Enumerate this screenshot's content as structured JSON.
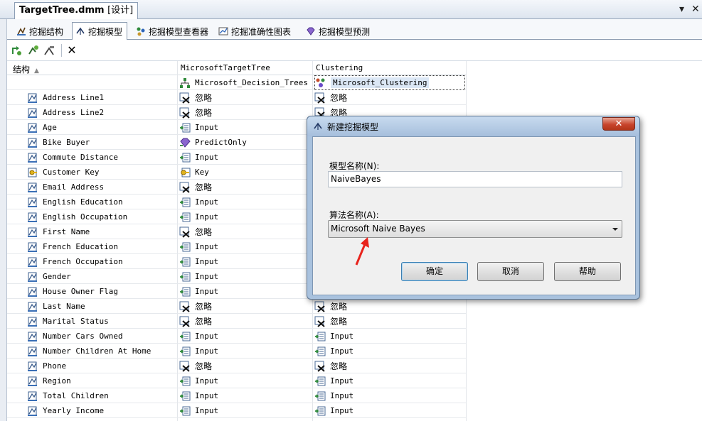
{
  "document": {
    "tab_title": "TargetTree.dmm",
    "tab_mode": "[设计]",
    "controls": [
      "▾",
      "✕"
    ]
  },
  "designer_tabs": [
    {
      "label": "挖掘结构",
      "icon": "mining-structure-icon"
    },
    {
      "label": "挖掘模型",
      "icon": "mining-model-icon"
    },
    {
      "label": "挖掘模型查看器",
      "icon": "model-viewer-icon"
    },
    {
      "label": "挖掘准确性图表",
      "icon": "accuracy-chart-icon"
    },
    {
      "label": "挖掘模型预测",
      "icon": "prediction-icon"
    }
  ],
  "toolbar": {
    "buttons": [
      "new-model-icon",
      "process-icon",
      "settings-icon",
      "delete-icon"
    ],
    "delete_glyph": "✕"
  },
  "grid": {
    "headers": {
      "structure": "结构",
      "sort_glyph": "▲",
      "model1": "MicrosoftTargetTree",
      "model2": "Clustering"
    },
    "algorithms": {
      "model1": "Microsoft_Decision_Trees",
      "model2": "Microsoft_Clustering"
    },
    "rows": [
      {
        "name": "Address Line1",
        "key": false,
        "u1": "忽略",
        "u2": "忽略"
      },
      {
        "name": "Address Line2",
        "key": false,
        "u1": "忽略",
        "u2": "忽略"
      },
      {
        "name": "Age",
        "key": false,
        "u1": "Input",
        "u2": ""
      },
      {
        "name": "Bike Buyer",
        "key": false,
        "u1": "PredictOnly",
        "u2": ""
      },
      {
        "name": "Commute Distance",
        "key": false,
        "u1": "Input",
        "u2": ""
      },
      {
        "name": "Customer Key",
        "key": true,
        "u1": "Key",
        "u2": ""
      },
      {
        "name": "Email Address",
        "key": false,
        "u1": "忽略",
        "u2": ""
      },
      {
        "name": "English Education",
        "key": false,
        "u1": "Input",
        "u2": ""
      },
      {
        "name": "English Occupation",
        "key": false,
        "u1": "Input",
        "u2": ""
      },
      {
        "name": "First Name",
        "key": false,
        "u1": "忽略",
        "u2": ""
      },
      {
        "name": "French Education",
        "key": false,
        "u1": "Input",
        "u2": ""
      },
      {
        "name": "French Occupation",
        "key": false,
        "u1": "Input",
        "u2": ""
      },
      {
        "name": "Gender",
        "key": false,
        "u1": "Input",
        "u2": ""
      },
      {
        "name": "House Owner Flag",
        "key": false,
        "u1": "Input",
        "u2": ""
      },
      {
        "name": "Last Name",
        "key": false,
        "u1": "忽略",
        "u2": "忽略"
      },
      {
        "name": "Marital Status",
        "key": false,
        "u1": "忽略",
        "u2": "忽略"
      },
      {
        "name": "Number Cars Owned",
        "key": false,
        "u1": "Input",
        "u2": "Input"
      },
      {
        "name": "Number Children At Home",
        "key": false,
        "u1": "Input",
        "u2": "Input"
      },
      {
        "name": "Phone",
        "key": false,
        "u1": "忽略",
        "u2": "忽略"
      },
      {
        "name": "Region",
        "key": false,
        "u1": "Input",
        "u2": "Input"
      },
      {
        "name": "Total Children",
        "key": false,
        "u1": "Input",
        "u2": "Input"
      },
      {
        "name": "Yearly Income",
        "key": false,
        "u1": "Input",
        "u2": "Input"
      }
    ]
  },
  "dialog": {
    "title": "新建挖掘模型",
    "close_glyph": "✕",
    "model_name_label": "模型名称(N):",
    "model_name_value": "NaiveBayes",
    "algorithm_label": "算法名称(A):",
    "algorithm_value": "Microsoft Naive Bayes",
    "buttons": {
      "ok": "确定",
      "cancel": "取消",
      "help": "帮助"
    }
  },
  "colors": {
    "annotation_arrow": "#e8231c",
    "dialog_frame": "#a9c2de",
    "close_button": "#c8452d"
  }
}
